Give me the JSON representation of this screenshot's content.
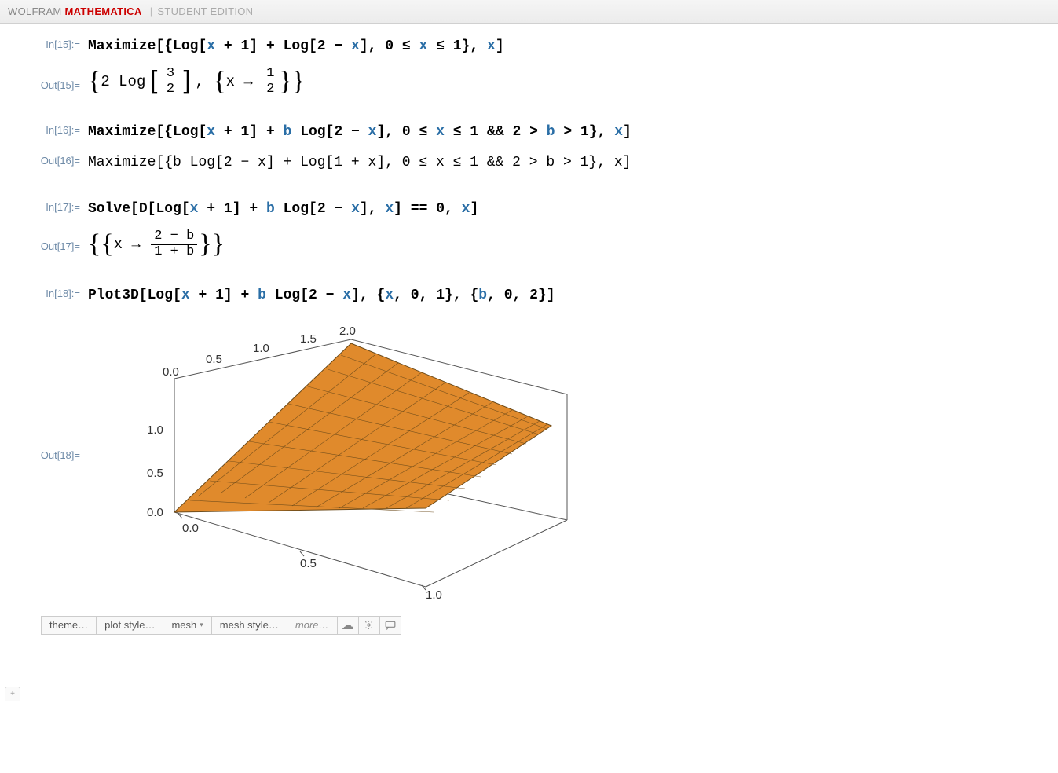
{
  "titlebar": {
    "wolfram": "WOLFRAM",
    "mathematica": "MATHEMATICA",
    "edition": "STUDENT EDITION"
  },
  "cells": {
    "in15_label": "In[15]:=",
    "out15_label": "Out[15]=",
    "in16_label": "In[16]:=",
    "out16_label": "Out[16]=",
    "in17_label": "In[17]:=",
    "out17_label": "Out[17]=",
    "in18_label": "In[18]:=",
    "out18_label": "Out[18]=",
    "in15_fn": "Maximize",
    "in15_log": "Log",
    "out15_coef": "2",
    "out15_log": "Log",
    "out15_frac_num": "3",
    "out15_frac_den": "2",
    "out15_x": "x",
    "out15_arrow": "→",
    "out15_half_num": "1",
    "out15_half_den": "2",
    "in16_fn": "Maximize",
    "in16_log": "Log",
    "out16_fn": "Maximize",
    "out16_log": "Log",
    "in17_fn": "Solve",
    "in17_d": "D",
    "in17_log": "Log",
    "out17_x": "x",
    "out17_arrow": "→",
    "out17_num": "2 − b",
    "out17_den": "1 + b",
    "in18_fn": "Plot3D",
    "in18_log": "Log"
  },
  "chart_data": {
    "type": "surface",
    "function": "Log[x+1] + b*Log[2-x]",
    "x_range": [
      0,
      1
    ],
    "b_range": [
      0,
      2
    ],
    "z_range_visible": [
      0.0,
      1.0
    ],
    "x_ticks": [
      0.0,
      0.5,
      1.0
    ],
    "b_ticks": [
      0.0,
      0.5,
      1.0,
      1.5,
      2.0
    ],
    "z_ticks": [
      0.0,
      0.5,
      1.0
    ],
    "surface_color": "#e08a2c"
  },
  "suggestions": {
    "theme": "theme…",
    "plot_style": "plot style…",
    "mesh": "mesh",
    "mesh_style": "mesh style…",
    "more": "more…"
  },
  "plot_ticks": {
    "b00": "0.0",
    "b05": "0.5",
    "b10": "1.0",
    "b15": "1.5",
    "b20": "2.0",
    "x00": "0.0",
    "x05": "0.5",
    "x10": "1.0",
    "z00": "0.0",
    "z05": "0.5",
    "z10": "1.0"
  }
}
